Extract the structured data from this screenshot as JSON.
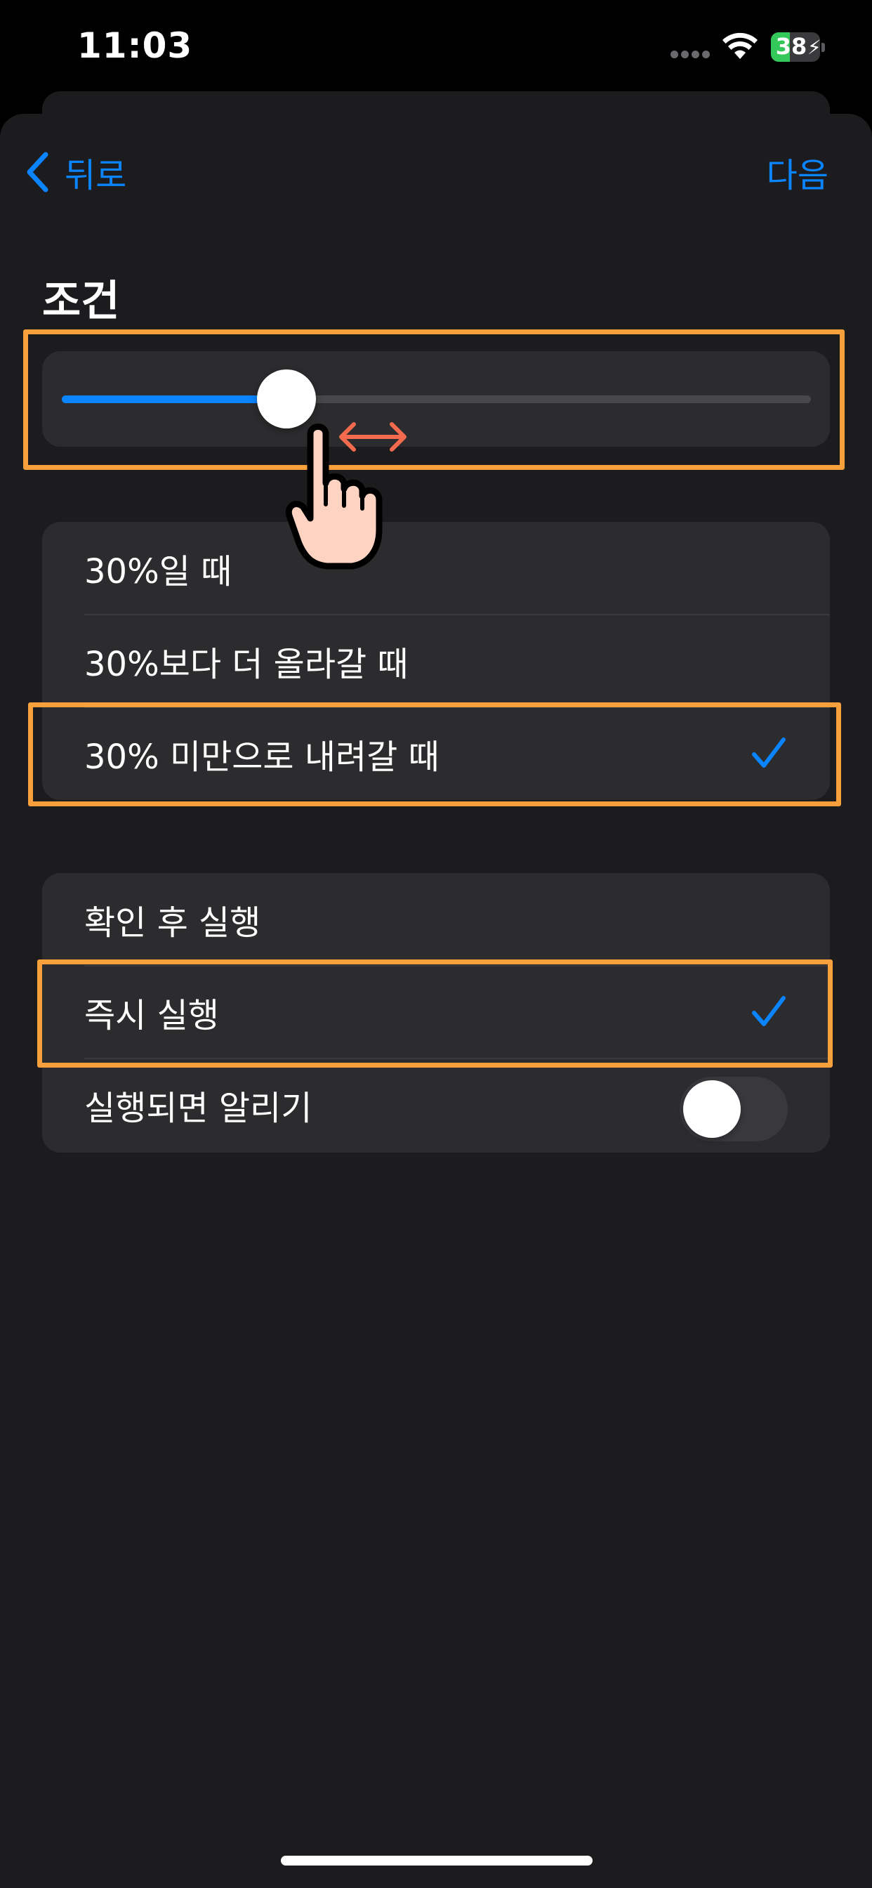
{
  "status_bar": {
    "time": "11:03",
    "battery_percent": "38",
    "battery_level": 0.38,
    "charging": true
  },
  "navigation": {
    "back_label": "뒤로",
    "next_label": "다음"
  },
  "condition": {
    "title": "조건",
    "slider_value_percent": 30,
    "options": [
      {
        "label": "30%일 때",
        "checked": false
      },
      {
        "label": "30%보다 더 올라갈 때",
        "checked": false
      },
      {
        "label": "30% 미만으로 내려갈 때",
        "checked": true
      }
    ]
  },
  "execution": {
    "options": [
      {
        "label": "확인 후 실행",
        "checked": false
      },
      {
        "label": "즉시 실행",
        "checked": true
      }
    ],
    "notify_label": "실행되면 알리기",
    "notify_enabled": false
  },
  "colors": {
    "accent": "#0a84ff",
    "highlight": "#f7a03c",
    "gesture_arrow": "#f46a4e",
    "battery": "#34c759"
  }
}
